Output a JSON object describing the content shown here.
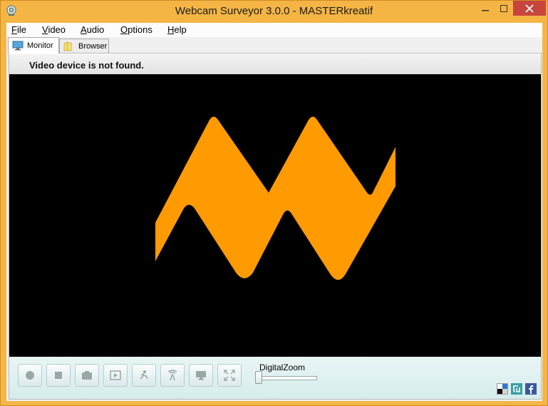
{
  "window": {
    "title": "Webcam Surveyor 3.0.0 - MASTERkreatif"
  },
  "menu": {
    "items": [
      "File",
      "Video",
      "Audio",
      "Options",
      "Help"
    ]
  },
  "tabs": [
    {
      "label": "Monitor",
      "active": true,
      "icon": "monitor-icon"
    },
    {
      "label": "Browser",
      "active": false,
      "icon": "folder-icon"
    }
  ],
  "status": {
    "message": "Video device is not found."
  },
  "video": {
    "logo": "masterkreatif-m-logo",
    "logo_color": "#ff9a00",
    "background": "#000000"
  },
  "controls": {
    "buttons": [
      "record-icon",
      "stop-icon",
      "snapshot-icon",
      "play-recordings-icon",
      "motion-detection-icon",
      "broadcast-icon",
      "display-icon",
      "fullscreen-icon"
    ],
    "zoom_label": "DigitalZoom",
    "zoom_value": 0
  },
  "social": {
    "links": [
      "delicious-icon",
      "stumbleupon-icon",
      "facebook-icon"
    ]
  },
  "colors": {
    "title_bar": "#f4b545",
    "close_button": "#c7453c"
  }
}
